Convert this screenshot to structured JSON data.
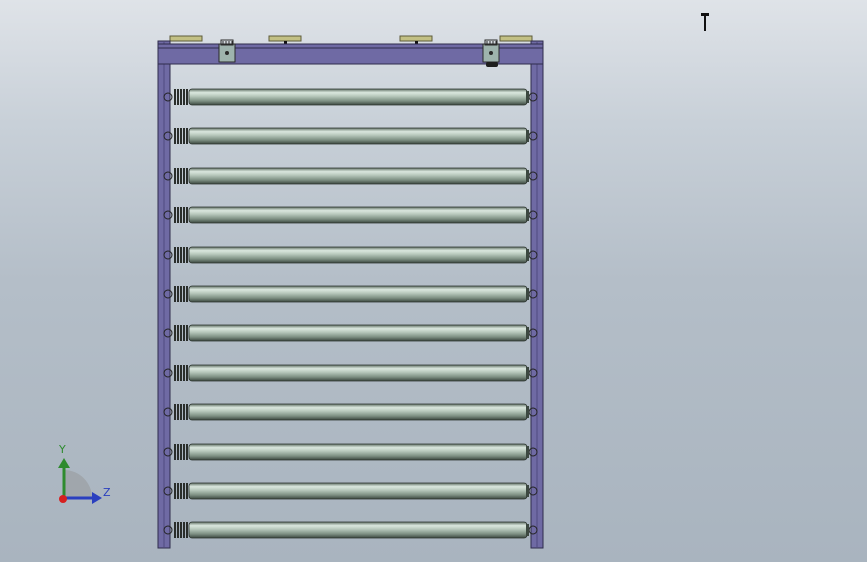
{
  "viewport": {
    "background_top": "#dfe3e8",
    "background_bottom": "#a9b4bf"
  },
  "model": {
    "frame_color": "#6f6aa4",
    "frame_edge": "#2f2c4c",
    "roller_count": 12,
    "roller_light": "#dbe8df",
    "roller_mid": "#8ea394",
    "roller_dark": "#3c4840",
    "top_plate_count": 4,
    "top_plate_color": "#c2c084",
    "motor_count": 2
  },
  "triad": {
    "y_label": "Y",
    "z_label": "Z",
    "y_color": "#2e8b2e",
    "z_color": "#2a3fbf",
    "origin_color": "#d62020",
    "icon": "view-orientation-triad-icon"
  },
  "pointer": {
    "icon": "text-cursor-icon"
  }
}
